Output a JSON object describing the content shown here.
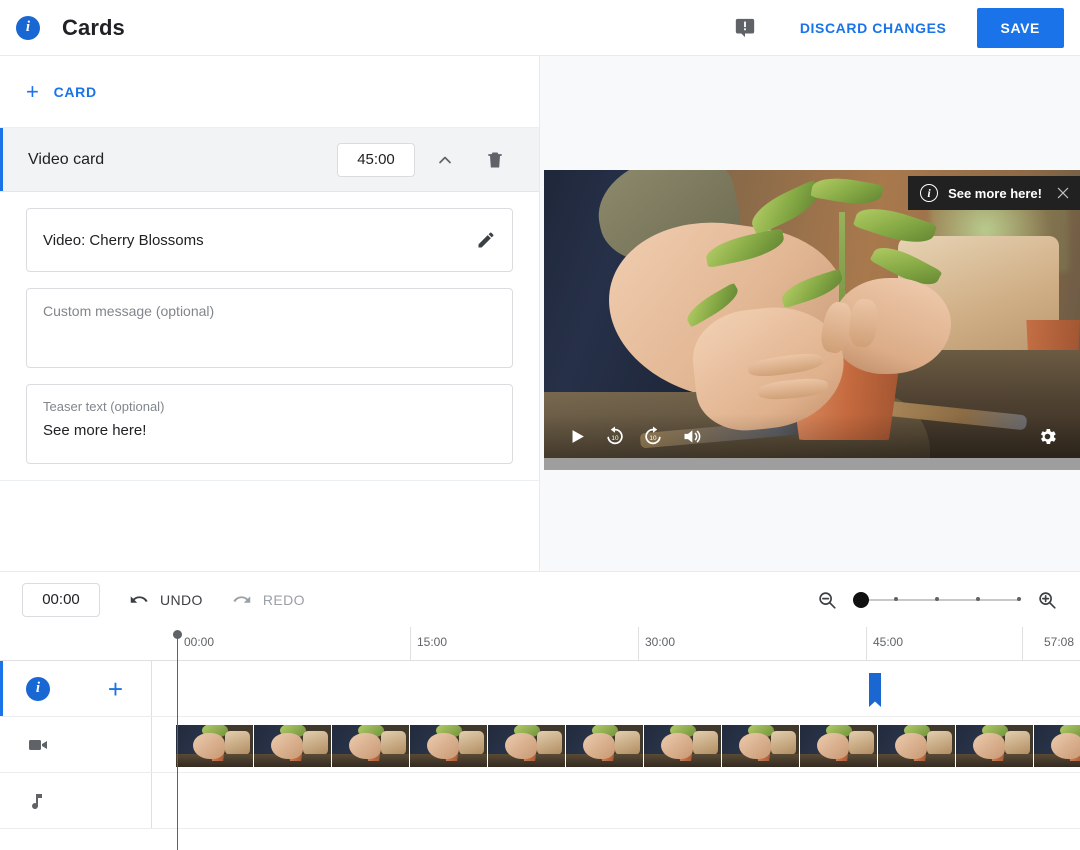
{
  "header": {
    "info_icon": "info-icon",
    "title": "Cards",
    "feedback_icon": "feedback-icon",
    "discard_label": "DISCARD CHANGES",
    "save_label": "SAVE",
    "accent_color": "#1a73e8"
  },
  "editor": {
    "add_card_label": "CARD",
    "add_card_plus": "+",
    "card": {
      "title": "Video card",
      "time": "45:00",
      "collapse_icon": "chevron-up-icon",
      "delete_icon": "trash-icon",
      "video_field": {
        "value": "Video: Cherry Blossoms",
        "edit_icon": "pencil-icon"
      },
      "custom_message": {
        "placeholder": "Custom message (optional)",
        "value": ""
      },
      "teaser_text": {
        "label": "Teaser text (optional)",
        "value": "See more here!"
      }
    }
  },
  "preview": {
    "tooltip": {
      "icon": "info-circle-icon",
      "text": "See more here!",
      "close_icon": "close-icon"
    },
    "controls": {
      "play": "play-icon",
      "rewind": "replay-10-icon",
      "forward": "forward-10-icon",
      "volume": "volume-icon",
      "settings": "gear-icon"
    }
  },
  "timeline_toolbar": {
    "current_time": "00:00",
    "undo_label": "UNDO",
    "undo_icon": "undo-icon",
    "redo_label": "REDO",
    "redo_icon": "redo-icon",
    "zoom_out_icon": "zoom-out-icon",
    "zoom_in_icon": "zoom-in-icon",
    "zoom_value": 0
  },
  "timeline": {
    "ruler_marks": [
      "00:00",
      "15:00",
      "30:00",
      "45:00"
    ],
    "duration_label": "57:08",
    "playhead_time": "00:00",
    "tracks": [
      {
        "name": "cards-track",
        "icon": "info-icon",
        "add_icon": "plus-icon"
      },
      {
        "name": "video-track",
        "icon": "video-camera-icon"
      },
      {
        "name": "audio-track",
        "icon": "music-note-icon"
      }
    ],
    "card_markers": [
      {
        "time": "45:00",
        "color": "#1a67d2"
      }
    ]
  }
}
